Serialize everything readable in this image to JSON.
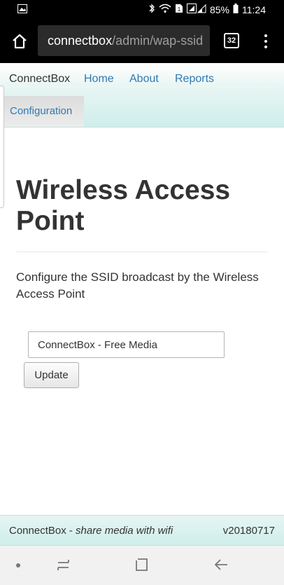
{
  "status_bar": {
    "battery": "85%",
    "time": "11:24",
    "icons": [
      "image-icon",
      "bluetooth-icon",
      "wifi-icon",
      "sim-icon",
      "signal-icon",
      "battery-icon"
    ]
  },
  "browser": {
    "url_host": "connectbox",
    "url_path": "/admin/wap-ssid",
    "tab_count": "32"
  },
  "navbar": {
    "brand": "ConnectBox",
    "links": [
      "Home",
      "About",
      "Reports"
    ],
    "active": "Configuration"
  },
  "main": {
    "title": "Wireless Access Point",
    "description": "Configure the SSID broadcast by the Wireless Access Point",
    "ssid_value": "ConnectBox - Free Media",
    "update_label": "Update"
  },
  "footer": {
    "brand": "ConnectBox - ",
    "tagline": "share media with wifi",
    "version": "v20180717"
  },
  "colors": {
    "link": "#2f7ab2",
    "navbar_teal": "#cfeeea",
    "chrome_bg": "#000000"
  }
}
